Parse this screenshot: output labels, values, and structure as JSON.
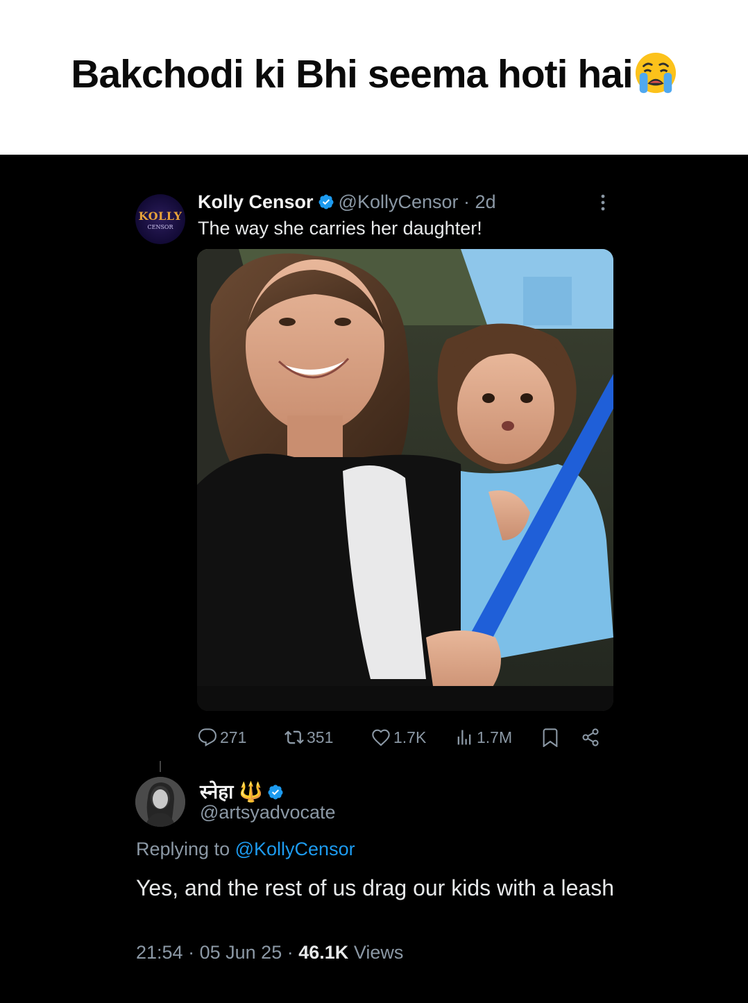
{
  "meme": {
    "caption": "Bakchodi ki Bhi seema hoti hai",
    "emoji": "crying-face-emoji"
  },
  "tweet": {
    "author_name": "Kolly Censor",
    "avatar_text_line1": "KOLLY",
    "avatar_text_line2": "CENSOR",
    "handle": "@KollyCensor",
    "separator": "·",
    "age": "2d",
    "text": "The way she carries her daughter!",
    "media_description": "photo-woman-holding-child",
    "stats": {
      "replies": "271",
      "reposts": "351",
      "likes": "1.7K",
      "views": "1.7M"
    }
  },
  "reply": {
    "author_name": "स्नेहा 🔱",
    "handle": "@artsyadvocate",
    "replying_prefix": "Replying to",
    "replying_to": "@KollyCensor",
    "text": "Yes, and the rest of us drag our kids with a leash",
    "time": "21:54",
    "date": "05 Jun 25",
    "meta_sep": "·",
    "views_count": "46.1K",
    "views_label": "Views"
  },
  "colors": {
    "background": "#000000",
    "text_primary": "#e7e9ea",
    "text_secondary": "#8b98a5",
    "accent": "#1d9bf0"
  }
}
